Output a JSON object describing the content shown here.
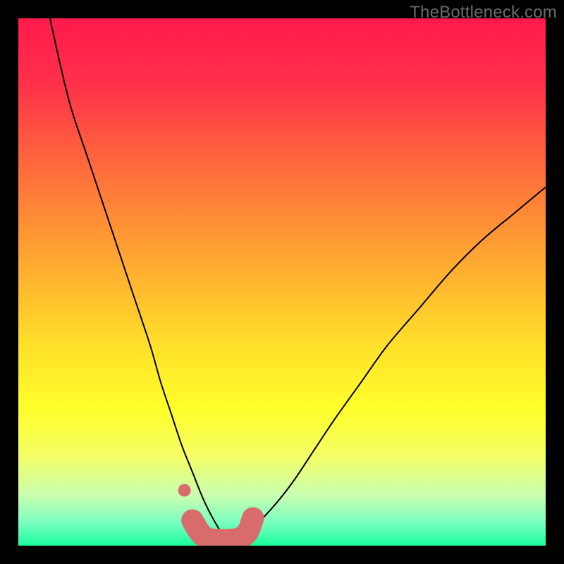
{
  "watermark": "TheBottleneck.com",
  "chart_data": {
    "type": "line",
    "title": "",
    "xlabel": "",
    "ylabel": "",
    "xlim": [
      0,
      100
    ],
    "ylim": [
      0,
      100
    ],
    "grid": false,
    "legend": false,
    "background": {
      "type": "vertical-gradient",
      "stops": [
        {
          "offset": 0.0,
          "color": "#ff1a4b"
        },
        {
          "offset": 0.12,
          "color": "#ff2f4a"
        },
        {
          "offset": 0.28,
          "color": "#ff6a3c"
        },
        {
          "offset": 0.45,
          "color": "#ffa531"
        },
        {
          "offset": 0.62,
          "color": "#ffe02a"
        },
        {
          "offset": 0.74,
          "color": "#ffff2a"
        },
        {
          "offset": 0.83,
          "color": "#f4ff66"
        },
        {
          "offset": 0.905,
          "color": "#c9ffb0"
        },
        {
          "offset": 0.955,
          "color": "#7dffc0"
        },
        {
          "offset": 1.0,
          "color": "#1aff9d"
        }
      ]
    },
    "series": [
      {
        "name": "bottleneck-curve",
        "stroke": "#000000",
        "stroke_width": 2,
        "x": [
          6,
          8,
          10,
          13,
          16,
          19,
          22,
          25,
          27,
          29,
          31,
          33,
          35,
          37,
          39,
          41,
          44,
          48,
          52,
          56,
          60,
          65,
          70,
          76,
          82,
          88,
          94,
          100
        ],
        "y": [
          100,
          91,
          83,
          74,
          65,
          56,
          47,
          38,
          31,
          25,
          19,
          14,
          9,
          5,
          2,
          2,
          3,
          7,
          12,
          18,
          24,
          31,
          38,
          45,
          52,
          58,
          63,
          68
        ]
      }
    ],
    "points": [
      {
        "name": "marker-left",
        "x": 31.5,
        "y": 10.5,
        "r": 1.2,
        "color": "#d86b6b"
      }
    ],
    "thick_segment": {
      "name": "bottom-highlight",
      "color": "#d86b6b",
      "width": 4.2,
      "x": [
        33.0,
        34.5,
        36.0,
        38.0,
        40.0,
        42.0,
        43.5,
        44.5
      ],
      "y": [
        4.8,
        2.4,
        1.3,
        1.1,
        1.1,
        1.4,
        2.6,
        5.2
      ]
    }
  }
}
